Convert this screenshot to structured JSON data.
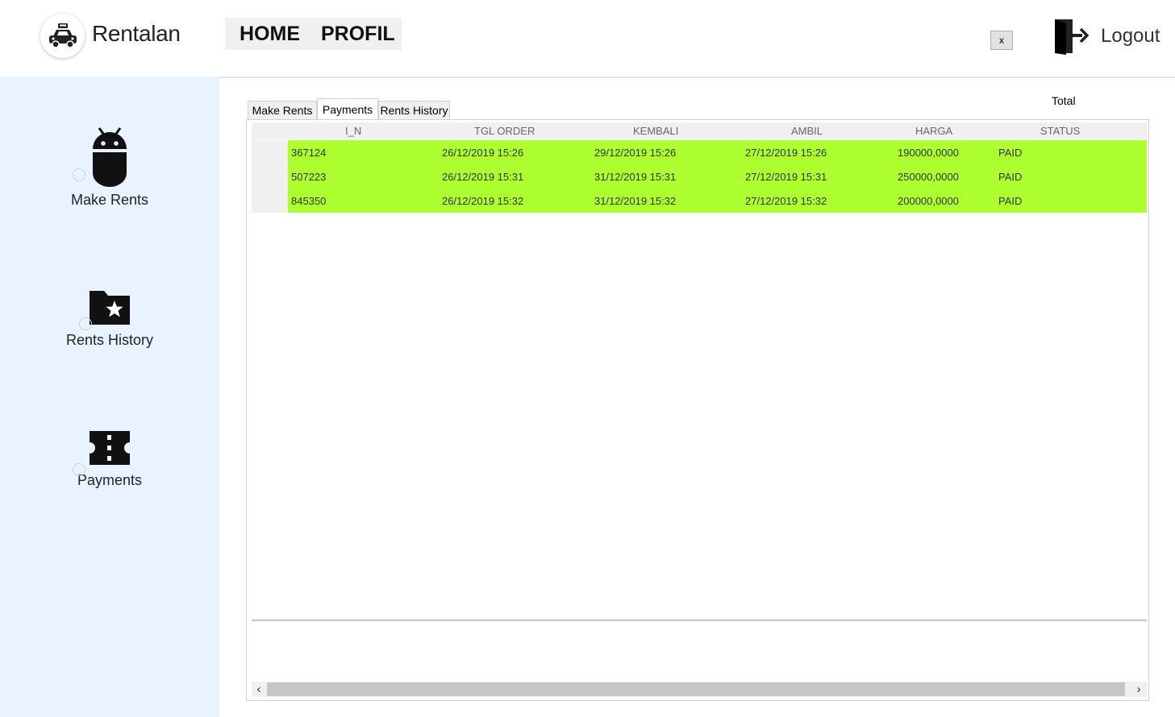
{
  "app": {
    "brand": "Rentalan"
  },
  "nav": {
    "home": "HOME",
    "profil": "PROFIL"
  },
  "header": {
    "close_label": "x",
    "logout_label": "Logout"
  },
  "sidebar": {
    "items": [
      {
        "label": "Make Rents",
        "icon": "android-icon"
      },
      {
        "label": "Rents History",
        "icon": "folder-star-icon"
      },
      {
        "label": "Payments",
        "icon": "ticket-icon"
      }
    ]
  },
  "tabs": [
    {
      "label": "Make Rents",
      "active": false
    },
    {
      "label": "Payments",
      "active": true
    },
    {
      "label": "Rents History",
      "active": false
    }
  ],
  "total_label": "Total",
  "table": {
    "columns": [
      "I_N",
      "TGL ORDER",
      "KEMBALI",
      "AMBIL",
      "HARGA",
      "STATUS"
    ],
    "rows": [
      [
        "367124",
        "26/12/2019 15:26",
        "29/12/2019 15:26",
        "27/12/2019 15:26",
        "190000,0000",
        "PAID"
      ],
      [
        "507223",
        "26/12/2019 15:31",
        "31/12/2019 15:31",
        "27/12/2019 15:31",
        "250000,0000",
        "PAID"
      ],
      [
        "845350",
        "26/12/2019 15:32",
        "31/12/2019 15:32",
        "27/12/2019 15:32",
        "200000,0000",
        "PAID"
      ]
    ],
    "row_color": "#adff2f"
  },
  "scrollbar": {
    "left_arrow": "‹",
    "right_arrow": "›"
  }
}
